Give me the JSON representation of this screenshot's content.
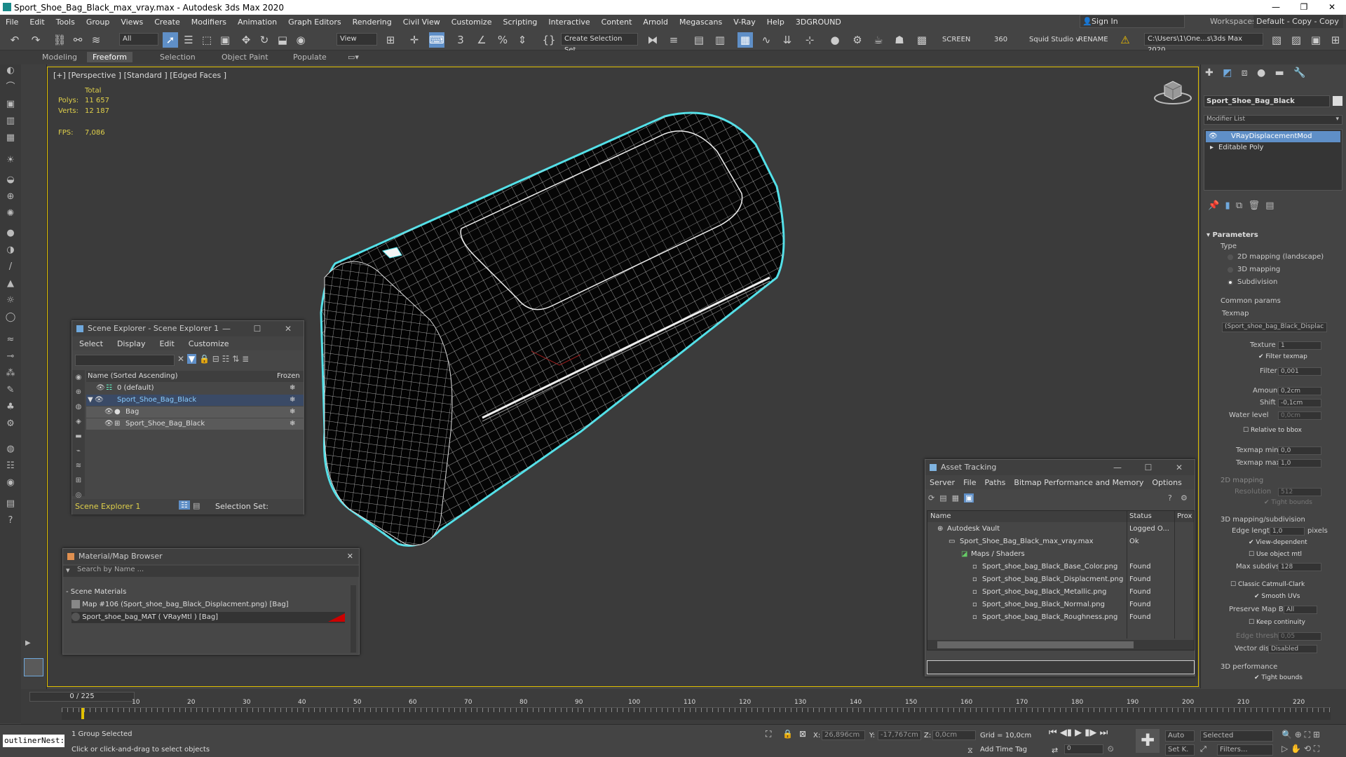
{
  "app": {
    "title": "Sport_Shoe_Bag_Black_max_vray.max - Autodesk 3ds Max 2020",
    "menu": [
      "File",
      "Edit",
      "Tools",
      "Group",
      "Views",
      "Create",
      "Modifiers",
      "Animation",
      "Graph Editors",
      "Rendering",
      "Civil View",
      "Customize",
      "Scripting",
      "Interactive",
      "Content",
      "Arnold",
      "Megascans",
      "V-Ray",
      "Help",
      "3DGROUND"
    ],
    "sign_in": "Sign In",
    "workspaces_label": "Workspaces:",
    "workspace_value": "Default - Copy - Copy - Copy"
  },
  "toolbar": {
    "filter": "All",
    "view_dropdown": "View",
    "selection_set": "Create Selection Set",
    "screen": "SCREEN",
    "num360": "360",
    "squid": "Squid Studio v",
    "rename": "RENAME",
    "path": "C:\\Users\\1\\One...s\\3ds Max 2020"
  },
  "ribbon": {
    "tabs": [
      "Modeling",
      "Freeform",
      "Selection",
      "Object Paint",
      "Populate"
    ],
    "active": "Freeform"
  },
  "viewport": {
    "label": "[+] [Perspective ] [Standard ] [Edged Faces ]",
    "total": "Total",
    "polys_label": "Polys:",
    "polys": "11 657",
    "verts_label": "Verts:",
    "verts": "12 187",
    "fps_label": "FPS:",
    "fps": "7,086"
  },
  "scene_explorer": {
    "title": "Scene Explorer - Scene Explorer 1",
    "menu": [
      "Select",
      "Display",
      "Edit",
      "Customize"
    ],
    "col_name": "Name (Sorted Ascending)",
    "col_frozen": "Frozen",
    "rows": [
      "0 (default)",
      "Sport_Shoe_Bag_Black",
      "Bag",
      "Sport_Shoe_Bag_Black"
    ],
    "footer_explorer": "Scene Explorer 1",
    "selection_set": "Selection Set:"
  },
  "material_browser": {
    "title": "Material/Map Browser",
    "search": "Search by Name ...",
    "section": "Scene Materials",
    "items": [
      "Map #106 (Sport_shoe_bag_Black_Displacment.png) [Bag]",
      "Sport_shoe_bag_MAT ( VRayMtl ) [Bag]"
    ]
  },
  "asset_tracking": {
    "title": "Asset Tracking",
    "menu": [
      "Server",
      "File",
      "Paths",
      "Bitmap Performance and Memory",
      "Options"
    ],
    "columns": [
      "Name",
      "Status",
      "Prox"
    ],
    "rows": [
      {
        "name": "Autodesk Vault",
        "status": "Logged O..."
      },
      {
        "name": "Sport_Shoe_Bag_Black_max_vray.max",
        "status": "Ok"
      },
      {
        "name": "Maps / Shaders",
        "status": ""
      },
      {
        "name": "Sport_shoe_bag_Black_Base_Color.png",
        "status": "Found"
      },
      {
        "name": "Sport_shoe_bag_Black_Displacment.png",
        "status": "Found"
      },
      {
        "name": "Sport_shoe_bag_Black_Metallic.png",
        "status": "Found"
      },
      {
        "name": "Sport_shoe_bag_Black_Normal.png",
        "status": "Found"
      },
      {
        "name": "Sport_shoe_bag_Black_Roughness.png",
        "status": "Found"
      }
    ]
  },
  "command_panel": {
    "object_name": "Sport_Shoe_Bag_Black",
    "modifier_list": "Modifier List",
    "stack": [
      "VRayDisplacementMod",
      "Editable Poly"
    ],
    "parameters": "Parameters",
    "type": "Type",
    "type_options": [
      "2D mapping (landscape)",
      "3D mapping",
      "Subdivision"
    ],
    "common": "Common params",
    "texmap": "Texmap",
    "texmap_value": "(Sport_shoe_bag_Black_Displac",
    "texture_chan": "Texture chan",
    "texture_chan_v": "1",
    "filter_texmap": "Filter texmap",
    "filter_blur": "Filter blur",
    "filter_blur_v": "0,001",
    "amount": "Amount",
    "amount_v": "0,2cm",
    "shift": "Shift",
    "shift_v": "-0,1cm",
    "water": "Water level",
    "water_v": "0,0cm",
    "relative": "Relative to bbox",
    "tmin": "Texmap min",
    "tmin_v": "0,0",
    "tmax": "Texmap max",
    "tmax_v": "1,0",
    "mapping2d": "2D mapping",
    "resolution": "Resolution",
    "resolution_v": "512",
    "tight": "Tight bounds",
    "mapping3d": "3D mapping/subdivision",
    "edge": "Edge length",
    "edge_v": "1,0",
    "pixels": "pixels",
    "viewdep": "View-dependent",
    "useobj": "Use object mtl",
    "maxsub": "Max subdivs",
    "maxsub_v": "128",
    "catmull": "Classic Catmull-Clark",
    "smooth": "Smooth UVs",
    "preserve": "Preserve Map Bnd",
    "preserve_v": "All",
    "keep": "Keep continuity",
    "edgethresh": "Edge thresh",
    "edgethresh_v": "0,05",
    "vector": "Vector displ",
    "vector_v": "Disabled",
    "perf": "3D performance",
    "tight2": "Tight bounds"
  },
  "timeline": {
    "frame": "0 / 225",
    "ticks": [
      "10",
      "20",
      "30",
      "40",
      "50",
      "60",
      "70",
      "80",
      "90",
      "100",
      "110",
      "120",
      "130",
      "140",
      "150",
      "160",
      "170",
      "180",
      "190",
      "200",
      "210",
      "220"
    ]
  },
  "status": {
    "outliner": "outlinerNest:",
    "selected": "1 Group Selected",
    "hint": "Click or click-and-drag to select objects",
    "x_label": "X:",
    "x": "26,896cm",
    "y_label": "Y:",
    "y": "-17,767cm",
    "z_label": "Z:",
    "z": "0,0cm",
    "grid": "Grid = 10,0cm",
    "add_time_tag": "Add Time Tag",
    "auto": "Auto",
    "selected_dd": "Selected",
    "setk": "Set K.",
    "filters": "Filters...",
    "frame_field": "0"
  }
}
